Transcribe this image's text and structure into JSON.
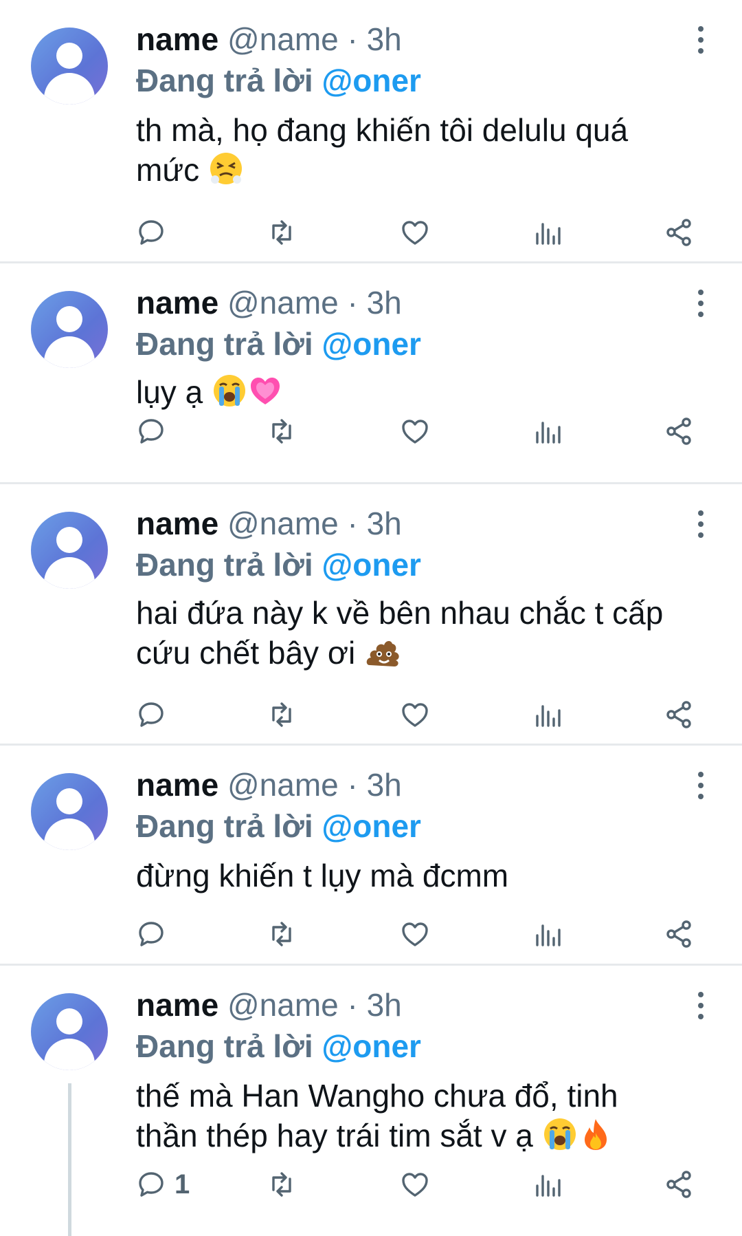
{
  "tweets": [
    {
      "name": "name",
      "handle": "@name · 3h",
      "reply_label": "Đang trả lời",
      "reply_to": "@oner",
      "text_lines": [
        "th mà, họ đang khiến tôi delulu quá",
        "mức"
      ],
      "emoji": [
        "persevering-face"
      ],
      "reply_count": ""
    },
    {
      "name": "name",
      "handle": "@name · 3h",
      "reply_label": "Đang trả lời",
      "reply_to": "@oner",
      "text_lines": [
        "lụy ạ"
      ],
      "emoji": [
        "loudly-crying-face",
        "growing-heart"
      ],
      "reply_count": ""
    },
    {
      "name": "name",
      "handle": "@name · 3h",
      "reply_label": "Đang trả lời",
      "reply_to": "@oner",
      "text_lines": [
        "hai đứa này k về bên nhau chắc t cấp",
        "cứu chết bây ơi"
      ],
      "emoji": [
        "pile-of-poo"
      ],
      "reply_count": ""
    },
    {
      "name": "name",
      "handle": "@name · 3h",
      "reply_label": "Đang trả lời",
      "reply_to": "@oner",
      "text_lines": [
        "đừng khiến t lụy mà đcmm"
      ],
      "emoji": [],
      "reply_count": ""
    },
    {
      "name": "name",
      "handle": "@name · 3h",
      "reply_label": "Đang trả lời",
      "reply_to": "@oner",
      "text_lines": [
        "thế mà Han Wangho chưa đổ, tinh",
        "thần thép hay trái tim sắt v ạ"
      ],
      "emoji": [
        "loudly-crying-face",
        "fire"
      ],
      "reply_count": "1"
    }
  ],
  "colors": {
    "accent": "#1d9bf0",
    "secondary": "#5b7083",
    "divider": "#e6e9ec"
  },
  "icons": {
    "reply": "reply-icon",
    "retweet": "retweet-icon",
    "like": "like-icon",
    "views": "views-icon",
    "share": "share-icon",
    "more": "more-icon"
  }
}
